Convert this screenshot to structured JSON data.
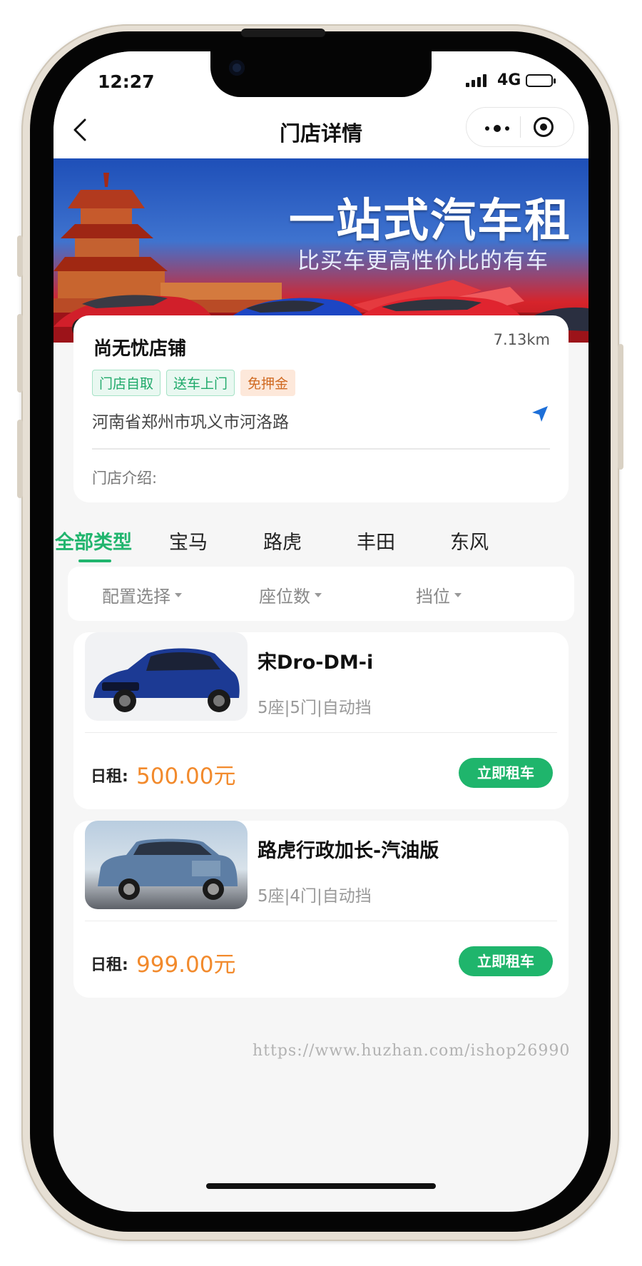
{
  "status_bar": {
    "time": "12:27",
    "network": "4G"
  },
  "nav": {
    "title": "门店详情"
  },
  "banner": {
    "title": "一站式汽车租",
    "subtitle": "比买车更高性价比的有车"
  },
  "store": {
    "name": "尚无忧店铺",
    "distance": "7.13km",
    "tags": [
      "门店自取",
      "送车上门",
      "免押金"
    ],
    "address": "河南省郑州市巩义市河洛路",
    "intro_label": "门店介绍:"
  },
  "brand_tabs": [
    "全部类型",
    "宝马",
    "路虎",
    "丰田",
    "东风"
  ],
  "filters": [
    "配置选择",
    "座位数",
    "挡位"
  ],
  "cars": [
    {
      "name": "宋Dro-DM-i",
      "spec": "5座|5门|自动挡",
      "price_label": "日租:",
      "price": "500.00元",
      "button": "立即租车"
    },
    {
      "name": "路虎行政加长-汽油版",
      "spec": "5座|4门|自动挡",
      "price_label": "日租:",
      "price": "999.00元",
      "button": "立即租车"
    }
  ],
  "watermark": "https://www.huzhan.com/ishop26990",
  "colors": {
    "accent": "#21b56e",
    "price": "#f28a2c",
    "button": "#1fb56c"
  }
}
